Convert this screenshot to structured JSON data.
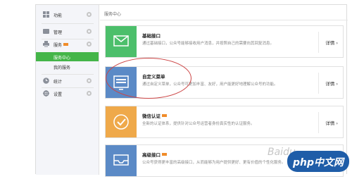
{
  "sidebar": {
    "items": [
      {
        "label": "功能",
        "icon": "grid-icon"
      },
      {
        "label": "管理",
        "icon": "folder-icon"
      },
      {
        "label": "服务",
        "icon": "printer-icon",
        "badge": true
      }
    ],
    "sub_items": [
      {
        "label": "服务中心",
        "active": true
      },
      {
        "label": "我的服务",
        "active": false
      }
    ],
    "bottom_items": [
      {
        "label": "统计",
        "icon": "clock-icon"
      },
      {
        "label": "设置",
        "icon": "gear-icon"
      }
    ]
  },
  "main": {
    "breadcrumb": "服务中心",
    "cards": [
      {
        "title": "基础接口",
        "desc": "通过基础接口，公众号能够接收用户消息，并按照自己的需要向其回复消息。",
        "detail": "详情",
        "color": "#4cbf6b",
        "icon": "mail-icon",
        "badge": false
      },
      {
        "title": "自定义菜单",
        "desc": "通过自定义菜单，公众号可更加丰富、友好，用户能更好地理解公众号的功能。",
        "detail": "详情",
        "color": "#5b8ac6",
        "icon": "menu-icon",
        "badge": false
      },
      {
        "title": "微信认证",
        "desc": "全新的认证体系，提供针对公众号运营者身份真实性的认证服务。",
        "detail": "详情",
        "color": "#efa94a",
        "icon": "check-icon",
        "badge": true
      },
      {
        "title": "高级接口",
        "desc": "公众号获得更丰富的高级接口，从而能够为用户提供更好、更有价值的个性化服务。",
        "detail": "详情",
        "color": "#5b8ac6",
        "icon": "inbox-icon",
        "badge": true
      }
    ]
  },
  "watermark": "Baidu",
  "logo": "php中文网"
}
